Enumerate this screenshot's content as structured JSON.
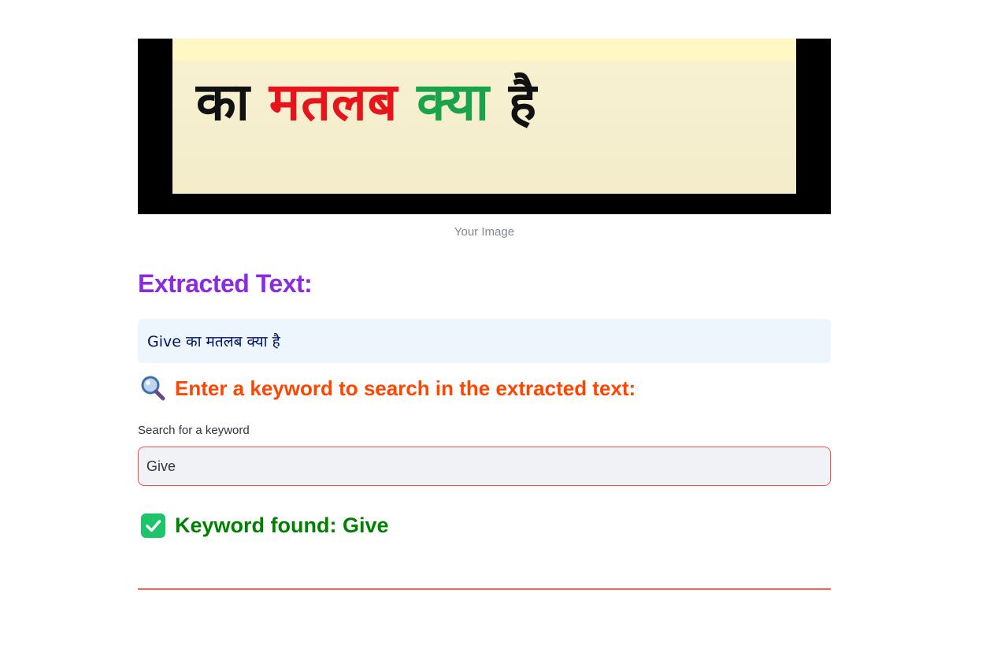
{
  "image": {
    "words": [
      {
        "text": "का",
        "color": "#111111"
      },
      {
        "text": "मतलब",
        "color": "#e8141b"
      },
      {
        "text": "क्या",
        "color": "#1aa34a"
      },
      {
        "text": "है",
        "color": "#111111"
      }
    ],
    "caption": "Your Image"
  },
  "extracted": {
    "heading": "Extracted Text:",
    "text": "Give का मतलब क्या है"
  },
  "search": {
    "icon": "magnifier-icon",
    "heading": "Enter a keyword to search in the extracted text:",
    "label": "Search for a keyword",
    "value": "Give"
  },
  "result": {
    "icon": "check-icon",
    "message": "Keyword found: Give"
  },
  "colors": {
    "heading_purple": "#8a2be2",
    "heading_orange": "#ff4500",
    "success_green": "#008000",
    "divider": "#ff6347",
    "input_border": "#ff4b4b"
  }
}
